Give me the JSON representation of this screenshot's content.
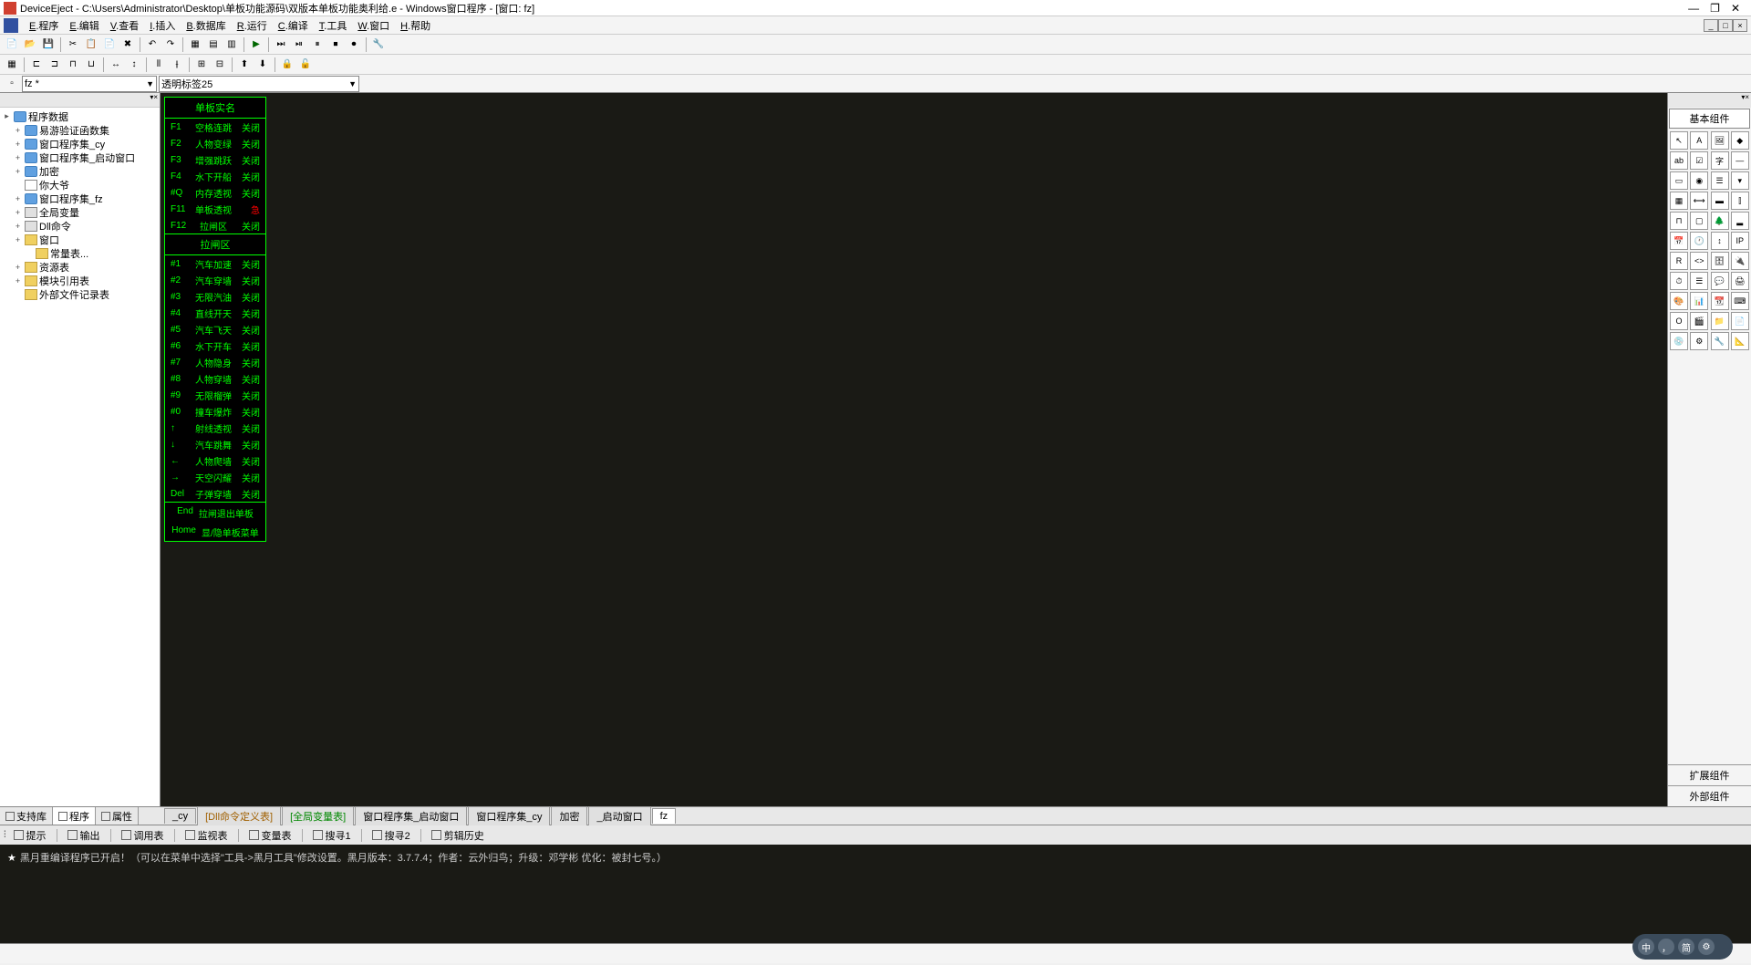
{
  "title": "DeviceEject - C:\\Users\\Administrator\\Desktop\\单板功能源码\\双版本单板功能奥利给.e - Windows窗口程序 - [窗口: fz]",
  "menu": [
    "E.程序",
    "E.编辑",
    "V.查看",
    "I.插入",
    "B.数据库",
    "R.运行",
    "C.编译",
    "T.工具",
    "W.窗口",
    "H.帮助"
  ],
  "combo1": "fz *",
  "combo2": "透明标签25",
  "tree_root": "程序数据",
  "tree": [
    {
      "exp": "+",
      "icon": "db",
      "label": "易游验证函数集"
    },
    {
      "exp": "+",
      "icon": "db",
      "label": "窗口程序集_cy"
    },
    {
      "exp": "+",
      "icon": "db",
      "label": "窗口程序集_启动窗口"
    },
    {
      "exp": "+",
      "icon": "db",
      "label": "加密"
    },
    {
      "exp": "",
      "icon": "file",
      "label": "你大爷"
    },
    {
      "exp": "+",
      "icon": "db",
      "label": "窗口程序集_fz"
    },
    {
      "exp": "+",
      "icon": "page",
      "label": "全局变量"
    },
    {
      "exp": "+",
      "icon": "page",
      "label": "Dll命令"
    },
    {
      "exp": "+",
      "icon": "folder",
      "label": "窗口"
    },
    {
      "exp": "",
      "icon": "folder",
      "label": "常量表...",
      "indent": true
    },
    {
      "exp": "+",
      "icon": "folder",
      "label": "资源表"
    },
    {
      "exp": "+",
      "icon": "folder",
      "label": "模块引用表"
    },
    {
      "exp": "",
      "icon": "folder",
      "label": "外部文件记录表"
    }
  ],
  "left_tabs": [
    {
      "label": "支持库",
      "active": false
    },
    {
      "label": "程序",
      "active": true
    },
    {
      "label": "属性",
      "active": false
    }
  ],
  "form_title": "单板实名",
  "form_rows1": [
    {
      "k": "F1",
      "n": "空格连跳",
      "s": "关闭"
    },
    {
      "k": "F2",
      "n": "人物变绿",
      "s": "关闭"
    },
    {
      "k": "F3",
      "n": "增强跳跃",
      "s": "关闭"
    },
    {
      "k": "F4",
      "n": "水下开船",
      "s": "关闭"
    },
    {
      "k": "#Q",
      "n": "内存透视",
      "s": "关闭"
    },
    {
      "k": "F11",
      "n": "单板透视",
      "s": "急",
      "red": true
    },
    {
      "k": "F12",
      "n": "拉闸区",
      "s": "关闭"
    }
  ],
  "form_title2": "拉闸区",
  "form_rows2": [
    {
      "k": "#1",
      "n": "汽车加速",
      "s": "关闭"
    },
    {
      "k": "#2",
      "n": "汽车穿墙",
      "s": "关闭"
    },
    {
      "k": "#3",
      "n": "无限汽油",
      "s": "关闭"
    },
    {
      "k": "#4",
      "n": "直线开天",
      "s": "关闭"
    },
    {
      "k": "#5",
      "n": "汽车飞天",
      "s": "关闭"
    },
    {
      "k": "#6",
      "n": "水下开车",
      "s": "关闭"
    },
    {
      "k": "#7",
      "n": "人物隐身",
      "s": "关闭"
    },
    {
      "k": "#8",
      "n": "人物穿墙",
      "s": "关闭"
    },
    {
      "k": "#9",
      "n": "无限榴弹",
      "s": "关闭"
    },
    {
      "k": "#0",
      "n": "撞车爆炸",
      "s": "关闭"
    },
    {
      "k": "↑",
      "n": "射线透视",
      "s": "关闭"
    },
    {
      "k": "↓",
      "n": "汽车跳舞",
      "s": "关闭"
    },
    {
      "k": "←",
      "n": "人物爬墙",
      "s": "关闭"
    },
    {
      "k": "→",
      "n": "天空闪耀",
      "s": "关闭"
    },
    {
      "k": "Del",
      "n": "子弹穿墙",
      "s": "关闭"
    }
  ],
  "form_ctrl": [
    {
      "k": "End",
      "n": "拉闸退出单板"
    },
    {
      "k": "Home",
      "n": "显/隐单板菜单"
    }
  ],
  "right_title": "基本组件",
  "right_bottom": [
    "扩展组件",
    "外部组件"
  ],
  "editor_tabs": [
    {
      "label": "_cy",
      "cls": ""
    },
    {
      "label": "[Dll命令定义表]",
      "cls": "orange"
    },
    {
      "label": "[全局变量表]",
      "cls": "green"
    },
    {
      "label": "窗口程序集_启动窗口",
      "cls": ""
    },
    {
      "label": "窗口程序集_cy",
      "cls": ""
    },
    {
      "label": "加密",
      "cls": ""
    },
    {
      "label": "_启动窗口",
      "cls": ""
    },
    {
      "label": "fz",
      "cls": "",
      "active": true
    }
  ],
  "bottom_tabs": [
    "提示",
    "输出",
    "调用表",
    "监视表",
    "变量表",
    "搜寻1",
    "搜寻2",
    "剪辑历史"
  ],
  "console_msg": "黑月重编译程序已开启！（可以在菜单中选择\"工具->黑月工具\"修改设置。黑月版本：3.7.7.4；作者：云外归鸟；升级：邓学彬 优化：被封七号。）"
}
